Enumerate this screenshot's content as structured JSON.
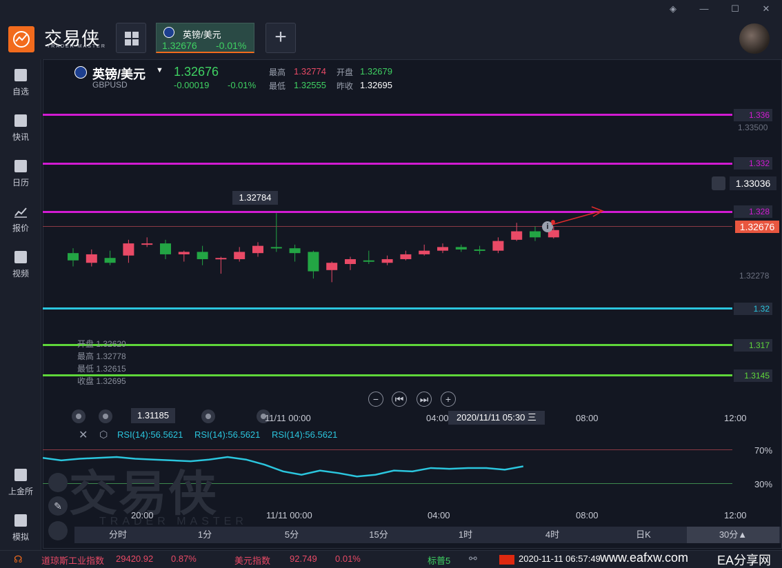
{
  "app": {
    "logo_text": "交易侠",
    "logo_sub": "TRADER MASTER",
    "window_controls": [
      "layers-icon",
      "minimize-icon",
      "maximize-icon",
      "close-icon"
    ]
  },
  "tab": {
    "label": "英镑/美元",
    "price": "1.32676",
    "change": "-0.01%"
  },
  "sidebar": {
    "items": [
      {
        "label": "自选",
        "icon": "bookmark-plus-icon"
      },
      {
        "label": "快讯",
        "icon": "news-list-icon"
      },
      {
        "label": "日历",
        "icon": "calendar-icon"
      },
      {
        "label": "报价",
        "icon": "chart-line-icon"
      },
      {
        "label": "视频",
        "icon": "play-icon"
      }
    ],
    "bottom_items": [
      {
        "label": "上金所",
        "icon": "exchange-icon"
      },
      {
        "label": "模拟",
        "icon": "wallet-icon"
      }
    ]
  },
  "quote": {
    "pair": "英镑/美元",
    "symbol": "GBPUSD",
    "price": "1.32676",
    "change": "-0.00019",
    "change_pct": "-0.01%",
    "high_label": "最高",
    "high": "1.32774",
    "open_label": "开盘",
    "open": "1.32679",
    "low_label": "最低",
    "low": "1.32555",
    "prev_close_label": "昨收",
    "prev_close": "1.32695"
  },
  "chart": {
    "peak_label": "1.32784",
    "low_label": "1.31185",
    "right_axis": [
      "1.33500",
      "1.33036",
      "1.32278"
    ],
    "current_price": "1.32676",
    "horizontal_lines": [
      {
        "value": "1.336",
        "color": "#d21bd2"
      },
      {
        "value": "1.332",
        "color": "#d21bd2"
      },
      {
        "value": "1.328",
        "color": "#d21bd2"
      },
      {
        "value": "1.32",
        "color": "#2bc6de"
      },
      {
        "value": "1.317",
        "color": "#5fd73a"
      },
      {
        "value": "1.3145",
        "color": "#5fd73a"
      }
    ],
    "ohlc_panel": {
      "open": "开盘 1.32620",
      "high": "最高 1.32778",
      "low": "最低 1.32615",
      "close": "收盘 1.32695"
    },
    "time_axis": [
      "20:00",
      "11/11 00:00",
      "04:00",
      "08:00",
      "12:00"
    ],
    "crosshair_time": "2020/11/11 05:30 三",
    "candles": [
      {
        "o": 1.3245,
        "h": 1.3249,
        "l": 1.3234,
        "c": 1.3239
      },
      {
        "o": 1.3237,
        "h": 1.3248,
        "l": 1.3234,
        "c": 1.3244
      },
      {
        "o": 1.3241,
        "h": 1.3247,
        "l": 1.3235,
        "c": 1.3237
      },
      {
        "o": 1.3243,
        "h": 1.3256,
        "l": 1.3237,
        "c": 1.3253
      },
      {
        "o": 1.3253,
        "h": 1.3258,
        "l": 1.325,
        "c": 1.3253
      },
      {
        "o": 1.3253,
        "h": 1.3256,
        "l": 1.324,
        "c": 1.3244
      },
      {
        "o": 1.3244,
        "h": 1.3247,
        "l": 1.3238,
        "c": 1.3246
      },
      {
        "o": 1.3246,
        "h": 1.3251,
        "l": 1.3235,
        "c": 1.324
      },
      {
        "o": 1.324,
        "h": 1.3242,
        "l": 1.3228,
        "c": 1.3241
      },
      {
        "o": 1.324,
        "h": 1.325,
        "l": 1.3238,
        "c": 1.3246
      },
      {
        "o": 1.3245,
        "h": 1.3254,
        "l": 1.3242,
        "c": 1.3251
      },
      {
        "o": 1.325,
        "h": 1.3278,
        "l": 1.3246,
        "c": 1.3249
      },
      {
        "o": 1.3249,
        "h": 1.3252,
        "l": 1.3238,
        "c": 1.3245
      },
      {
        "o": 1.3246,
        "h": 1.3247,
        "l": 1.3224,
        "c": 1.323
      },
      {
        "o": 1.3231,
        "h": 1.3238,
        "l": 1.3221,
        "c": 1.3237
      },
      {
        "o": 1.3236,
        "h": 1.3242,
        "l": 1.3231,
        "c": 1.324
      },
      {
        "o": 1.3239,
        "h": 1.3247,
        "l": 1.3236,
        "c": 1.3238
      },
      {
        "o": 1.3237,
        "h": 1.3243,
        "l": 1.3235,
        "c": 1.324
      },
      {
        "o": 1.324,
        "h": 1.3247,
        "l": 1.3239,
        "c": 1.3244
      },
      {
        "o": 1.3244,
        "h": 1.3252,
        "l": 1.3243,
        "c": 1.3247
      },
      {
        "o": 1.3247,
        "h": 1.3253,
        "l": 1.3245,
        "c": 1.325
      },
      {
        "o": 1.325,
        "h": 1.3252,
        "l": 1.3246,
        "c": 1.3248
      },
      {
        "o": 1.3248,
        "h": 1.3251,
        "l": 1.3244,
        "c": 1.3247
      },
      {
        "o": 1.3247,
        "h": 1.3258,
        "l": 1.3245,
        "c": 1.3255
      },
      {
        "o": 1.3256,
        "h": 1.327,
        "l": 1.3255,
        "c": 1.3263
      },
      {
        "o": 1.3263,
        "h": 1.3267,
        "l": 1.3255,
        "c": 1.3258
      },
      {
        "o": 1.3258,
        "h": 1.3267,
        "l": 1.3257,
        "c": 1.3264
      }
    ],
    "ylim": [
      1.3125,
      1.338
    ]
  },
  "chart_data": {
    "type": "line",
    "title": "",
    "xlabel": "",
    "ylabel": "",
    "series": [
      {
        "name": "RSI(14)",
        "values": [
          60,
          57,
          59,
          60,
          61,
          59,
          58,
          57,
          56,
          58,
          61,
          58,
          52,
          44,
          40,
          45,
          42,
          38,
          40,
          45,
          44,
          48,
          47,
          48,
          48,
          46,
          50
        ]
      }
    ],
    "ylim": [
      0,
      100
    ]
  },
  "indicator": {
    "labels": [
      "RSI(14):56.5621",
      "RSI(14):56.5621",
      "RSI(14):56.5621"
    ],
    "levels": [
      "70%",
      "30%"
    ],
    "time_axis": [
      "20:00",
      "11/11 00:00",
      "04:00",
      "08:00",
      "12:00"
    ]
  },
  "timeframes": [
    "分时",
    "1分",
    "5分",
    "15分",
    "1时",
    "4时",
    "日K",
    "30分▲"
  ],
  "ticker": {
    "items": [
      {
        "name": "道琼斯工业指数",
        "value": "29420.92",
        "change": "0.87%"
      },
      {
        "name": "美元指数",
        "value": "92.749",
        "change": "0.01%"
      },
      {
        "name": "标普5",
        "value": "",
        "change": ""
      }
    ],
    "datetime": "2020-11-11 06:57:49",
    "watermark": "www.eafxw.com",
    "watermark2": "EA分享网"
  },
  "colors": {
    "up": "#e94a66",
    "down": "#23a544",
    "accent": "#f26b1d"
  }
}
